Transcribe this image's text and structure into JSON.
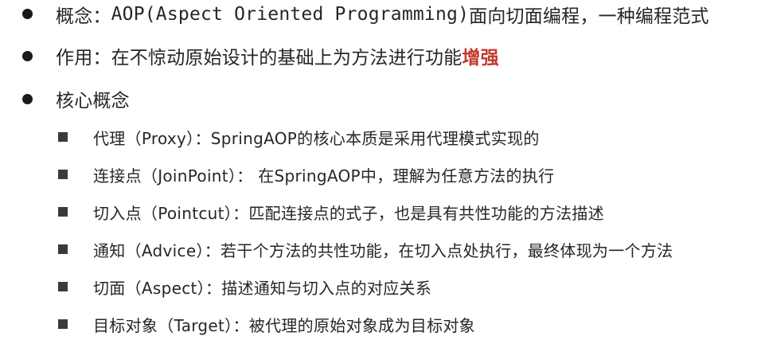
{
  "top_points": [
    {
      "label": "概念：",
      "term": "AOP(Aspect Oriented Programming)",
      "rest": "面向切面编程，一种编程范式"
    },
    {
      "label": "作用：",
      "text": "在不惊动原始设计的基础上为方法进行功能",
      "highlight": "增强",
      "highlight_color": "#c0392b"
    },
    {
      "label": "核心概念"
    }
  ],
  "sub_points": [
    {
      "term": "代理（Proxy）：",
      "desc": "SpringAOP的核心本质是采用代理模式实现的"
    },
    {
      "term": "连接点（JoinPoint）：",
      "desc": " 在SpringAOP中，理解为任意方法的执行"
    },
    {
      "term": "切入点（Pointcut）：",
      "desc": "匹配连接点的式子，也是具有共性功能的方法描述"
    },
    {
      "term": "通知（Advice）：",
      "desc": "若干个方法的共性功能，在切入点处执行，最终体现为一个方法"
    },
    {
      "term": "切面（Aspect）：",
      "desc": "描述通知与切入点的对应关系"
    },
    {
      "term": "目标对象（Target）：",
      "desc": "被代理的原始对象成为目标对象"
    }
  ]
}
